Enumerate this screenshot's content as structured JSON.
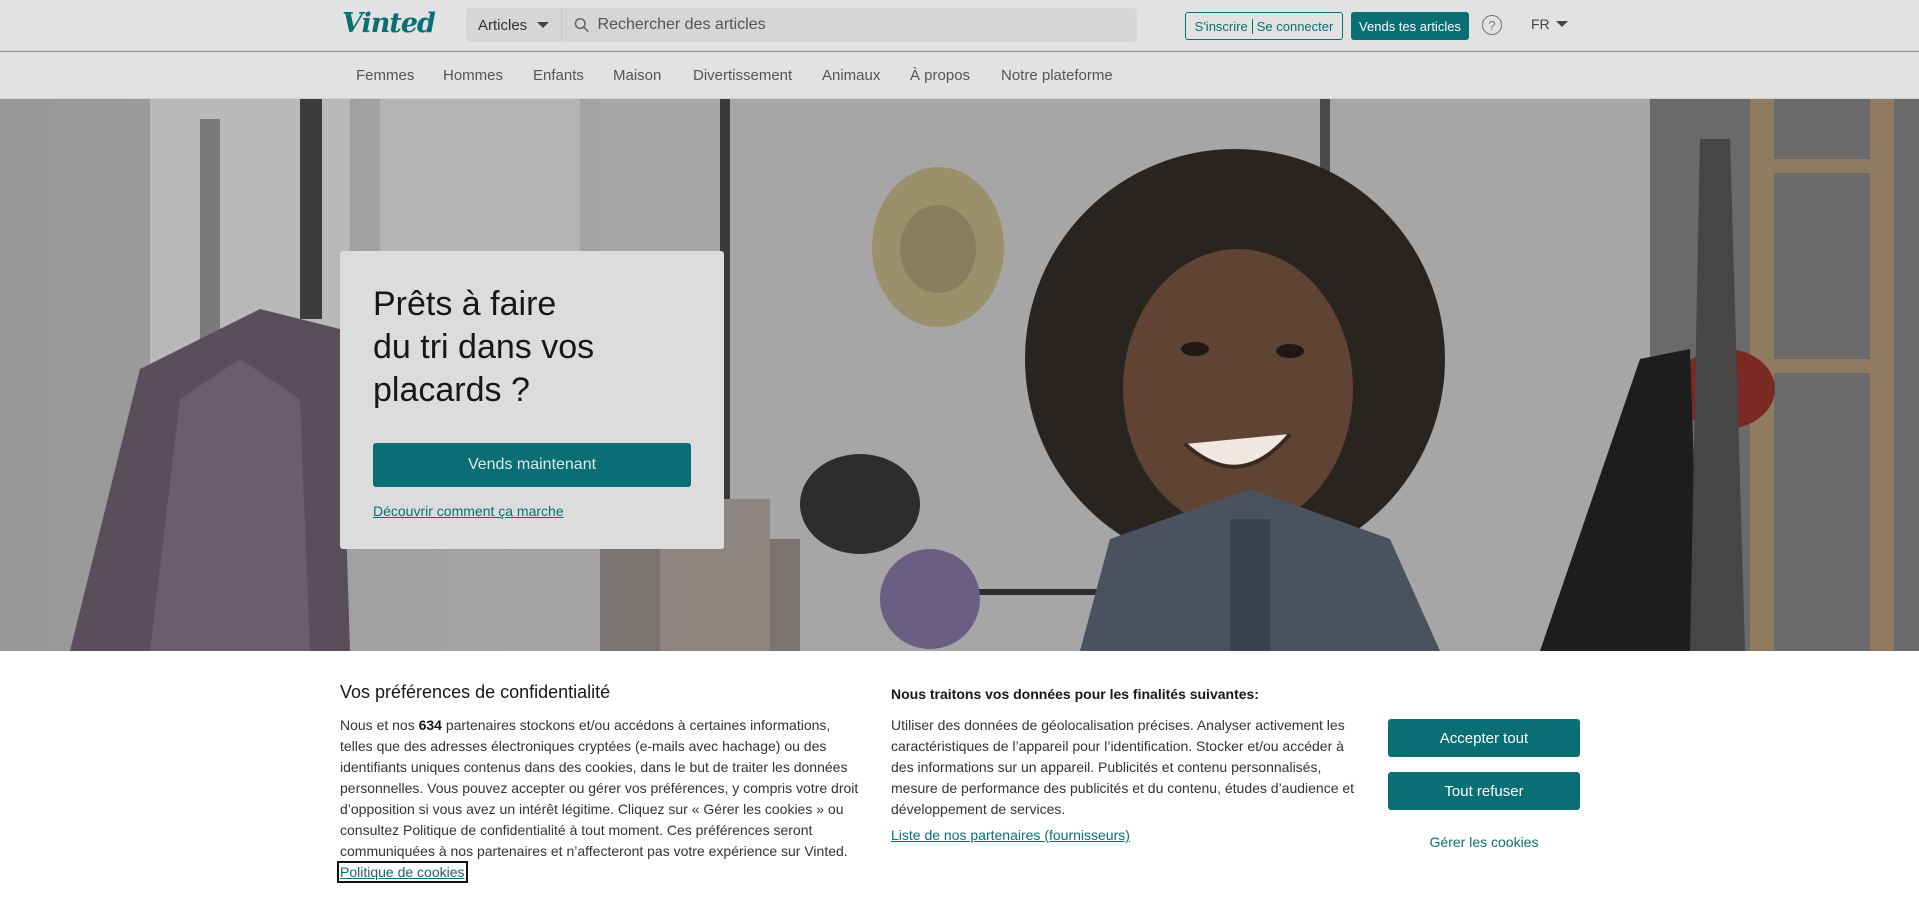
{
  "header": {
    "logo": "Vinted",
    "search_category": "Articles",
    "search_placeholder": "Rechercher des articles",
    "signup": "S'inscrire",
    "login": "Se connecter",
    "sell_button": "Vends tes articles",
    "help_icon": "?",
    "language": "FR"
  },
  "nav": {
    "items": [
      "Femmes",
      "Hommes",
      "Enfants",
      "Maison",
      "Divertissement",
      "Animaux",
      "À propos",
      "Notre plateforme"
    ]
  },
  "hero": {
    "title_line1": "Prêts à faire",
    "title_line2": "du tri dans vos",
    "title_line3": "placards ?",
    "cta": "Vends maintenant",
    "link": "Découvrir comment ça marche"
  },
  "cookie": {
    "title": "Vos préférences de confidentialité",
    "desc_before": "Nous et nos",
    "partner_count": "634",
    "desc_after": "partenaires stockons et/ou accédons à certaines informations, telles que des adresses électroniques cryptées (e-mails avec hachage) ou des identifiants uniques contenus dans des cookies, dans le but de traiter les données personnelles. Vous pouvez accepter ou gérer vos préférences, y compris votre droit d’opposition si vous avez un intérêt légitime. Cliquez sur « Gérer les cookies » ou consultez Politique de confidentialité à tout moment. Ces préférences seront communiquées à nos partenaires et n’affecteront pas votre expérience sur Vinted.",
    "policy_link": "Politique de cookies",
    "purposes_title": "Nous traitons vos données pour les finalités suivantes:",
    "purposes": "Utiliser des données de géolocalisation précises. Analyser activement les caractéristiques de l’appareil pour l’identification. Stocker et/ou accéder à des informations sur un appareil. Publicités et contenu personnalisés, mesure de performance des publicités et du contenu, études d’audience et développement de services.",
    "partners_link": "Liste de nos partenaires (fournisseurs)",
    "accept": "Accepter tout",
    "refuse": "Tout refuser",
    "manage": "Gérer les cookies"
  },
  "colors": {
    "brand": "#0a6f74"
  }
}
